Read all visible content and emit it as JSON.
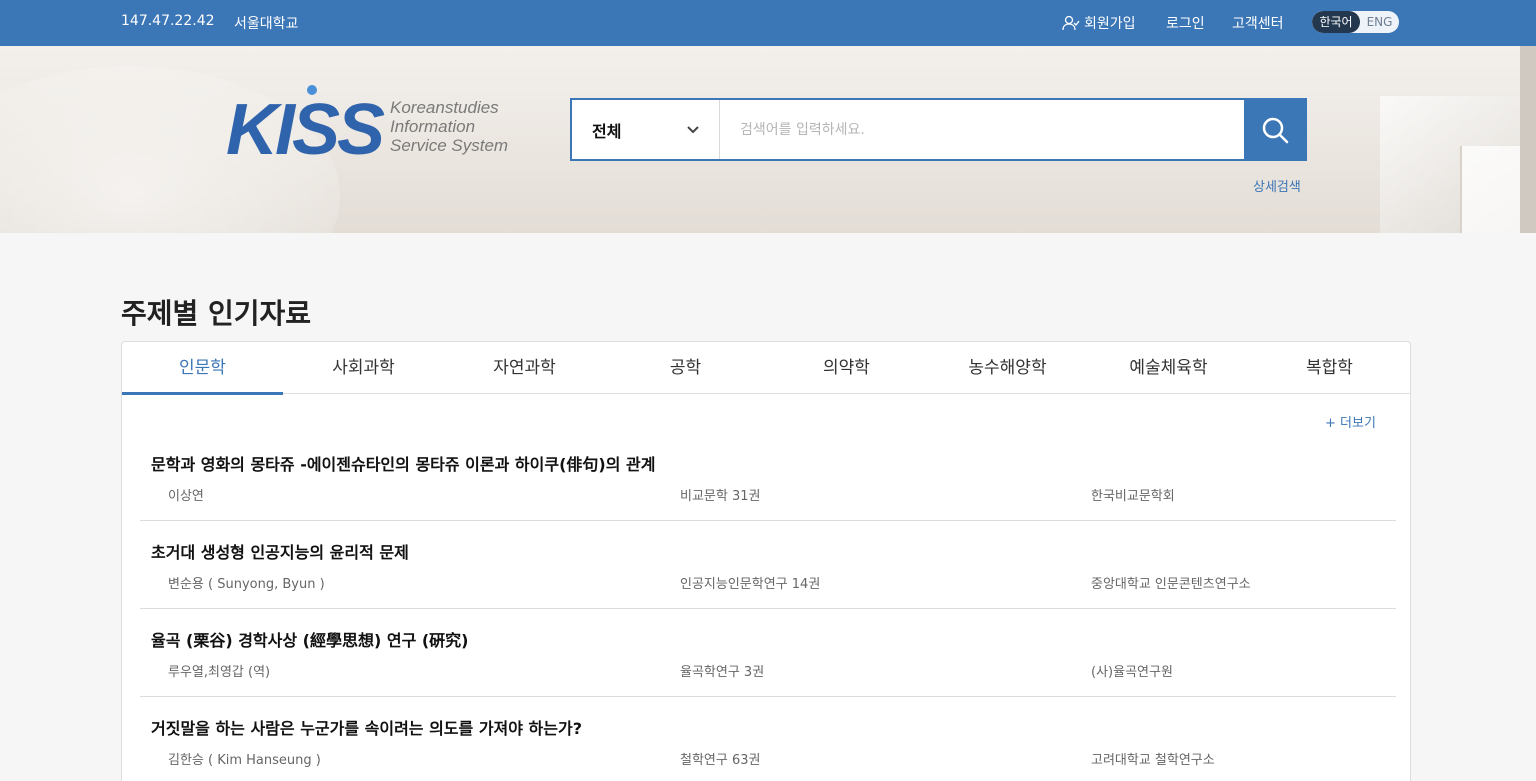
{
  "topbar": {
    "ip": "147.47.22.42",
    "institution": "서울대학교",
    "join": "회원가입",
    "login": "로그인",
    "support": "고객센터",
    "lang_ko": "한국어",
    "lang_en": "ENG"
  },
  "logo": {
    "mark": "KISS",
    "line1": "Koreanstudies",
    "line2": "Information",
    "line3": "Service System"
  },
  "search": {
    "scope": "전체",
    "placeholder": "검색어를 입력하세요.",
    "advanced": "상세검색"
  },
  "section": {
    "title": "주제별 인기자료",
    "more": "+ 더보기"
  },
  "tabs": [
    {
      "label": "인문학"
    },
    {
      "label": "사회과학"
    },
    {
      "label": "자연과학"
    },
    {
      "label": "공학"
    },
    {
      "label": "의약학"
    },
    {
      "label": "농수해양학"
    },
    {
      "label": "예술체육학"
    },
    {
      "label": "복합학"
    }
  ],
  "articles": [
    {
      "title": "문학과 영화의 몽타쥬 -에이젠슈타인의 몽타쥬 이론과 하이쿠(俳句)의 관계",
      "author": "이상연",
      "journal": "비교문학 31권",
      "publisher": "한국비교문학회"
    },
    {
      "title": "초거대 생성형 인공지능의 윤리적 문제",
      "author": "변순용 ( Sunyong, Byun )",
      "journal": "인공지능인문학연구 14권",
      "publisher": "중앙대학교 인문콘텐츠연구소"
    },
    {
      "title": "율곡 (栗谷) 경학사상 (經學思想) 연구 (硏究)",
      "author": "루우열,최영갑 (역)",
      "journal": "율곡학연구 3권",
      "publisher": "(사)율곡연구원"
    },
    {
      "title": "거짓말을 하는 사람은 누군가를 속이려는 의도를 가져야 하는가?",
      "author": "김한승 ( Kim Hanseung )",
      "journal": "철학연구 63권",
      "publisher": "고려대학교 철학연구소"
    }
  ],
  "colors": {
    "brand": "#3b76b6",
    "logo_blue": "#2f64ad"
  }
}
